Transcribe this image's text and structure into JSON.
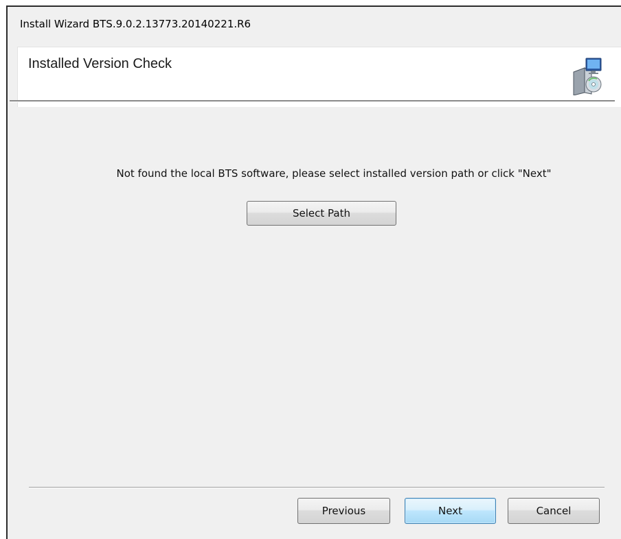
{
  "window": {
    "title": "Install Wizard BTS.9.0.2.13773.20140221.R6"
  },
  "header": {
    "title": "Installed Version Check",
    "icon": "installer-setup-icon"
  },
  "main": {
    "message": "Not found the local BTS software, please select installed version path or click \"Next\"",
    "select_path_label": "Select Path"
  },
  "footer": {
    "previous_label": "Previous",
    "next_label": "Next",
    "cancel_label": "Cancel"
  },
  "colors": {
    "dialog_background": "#f0f0f0",
    "header_background": "#ffffff",
    "default_button_border": "#3c7fb1"
  }
}
